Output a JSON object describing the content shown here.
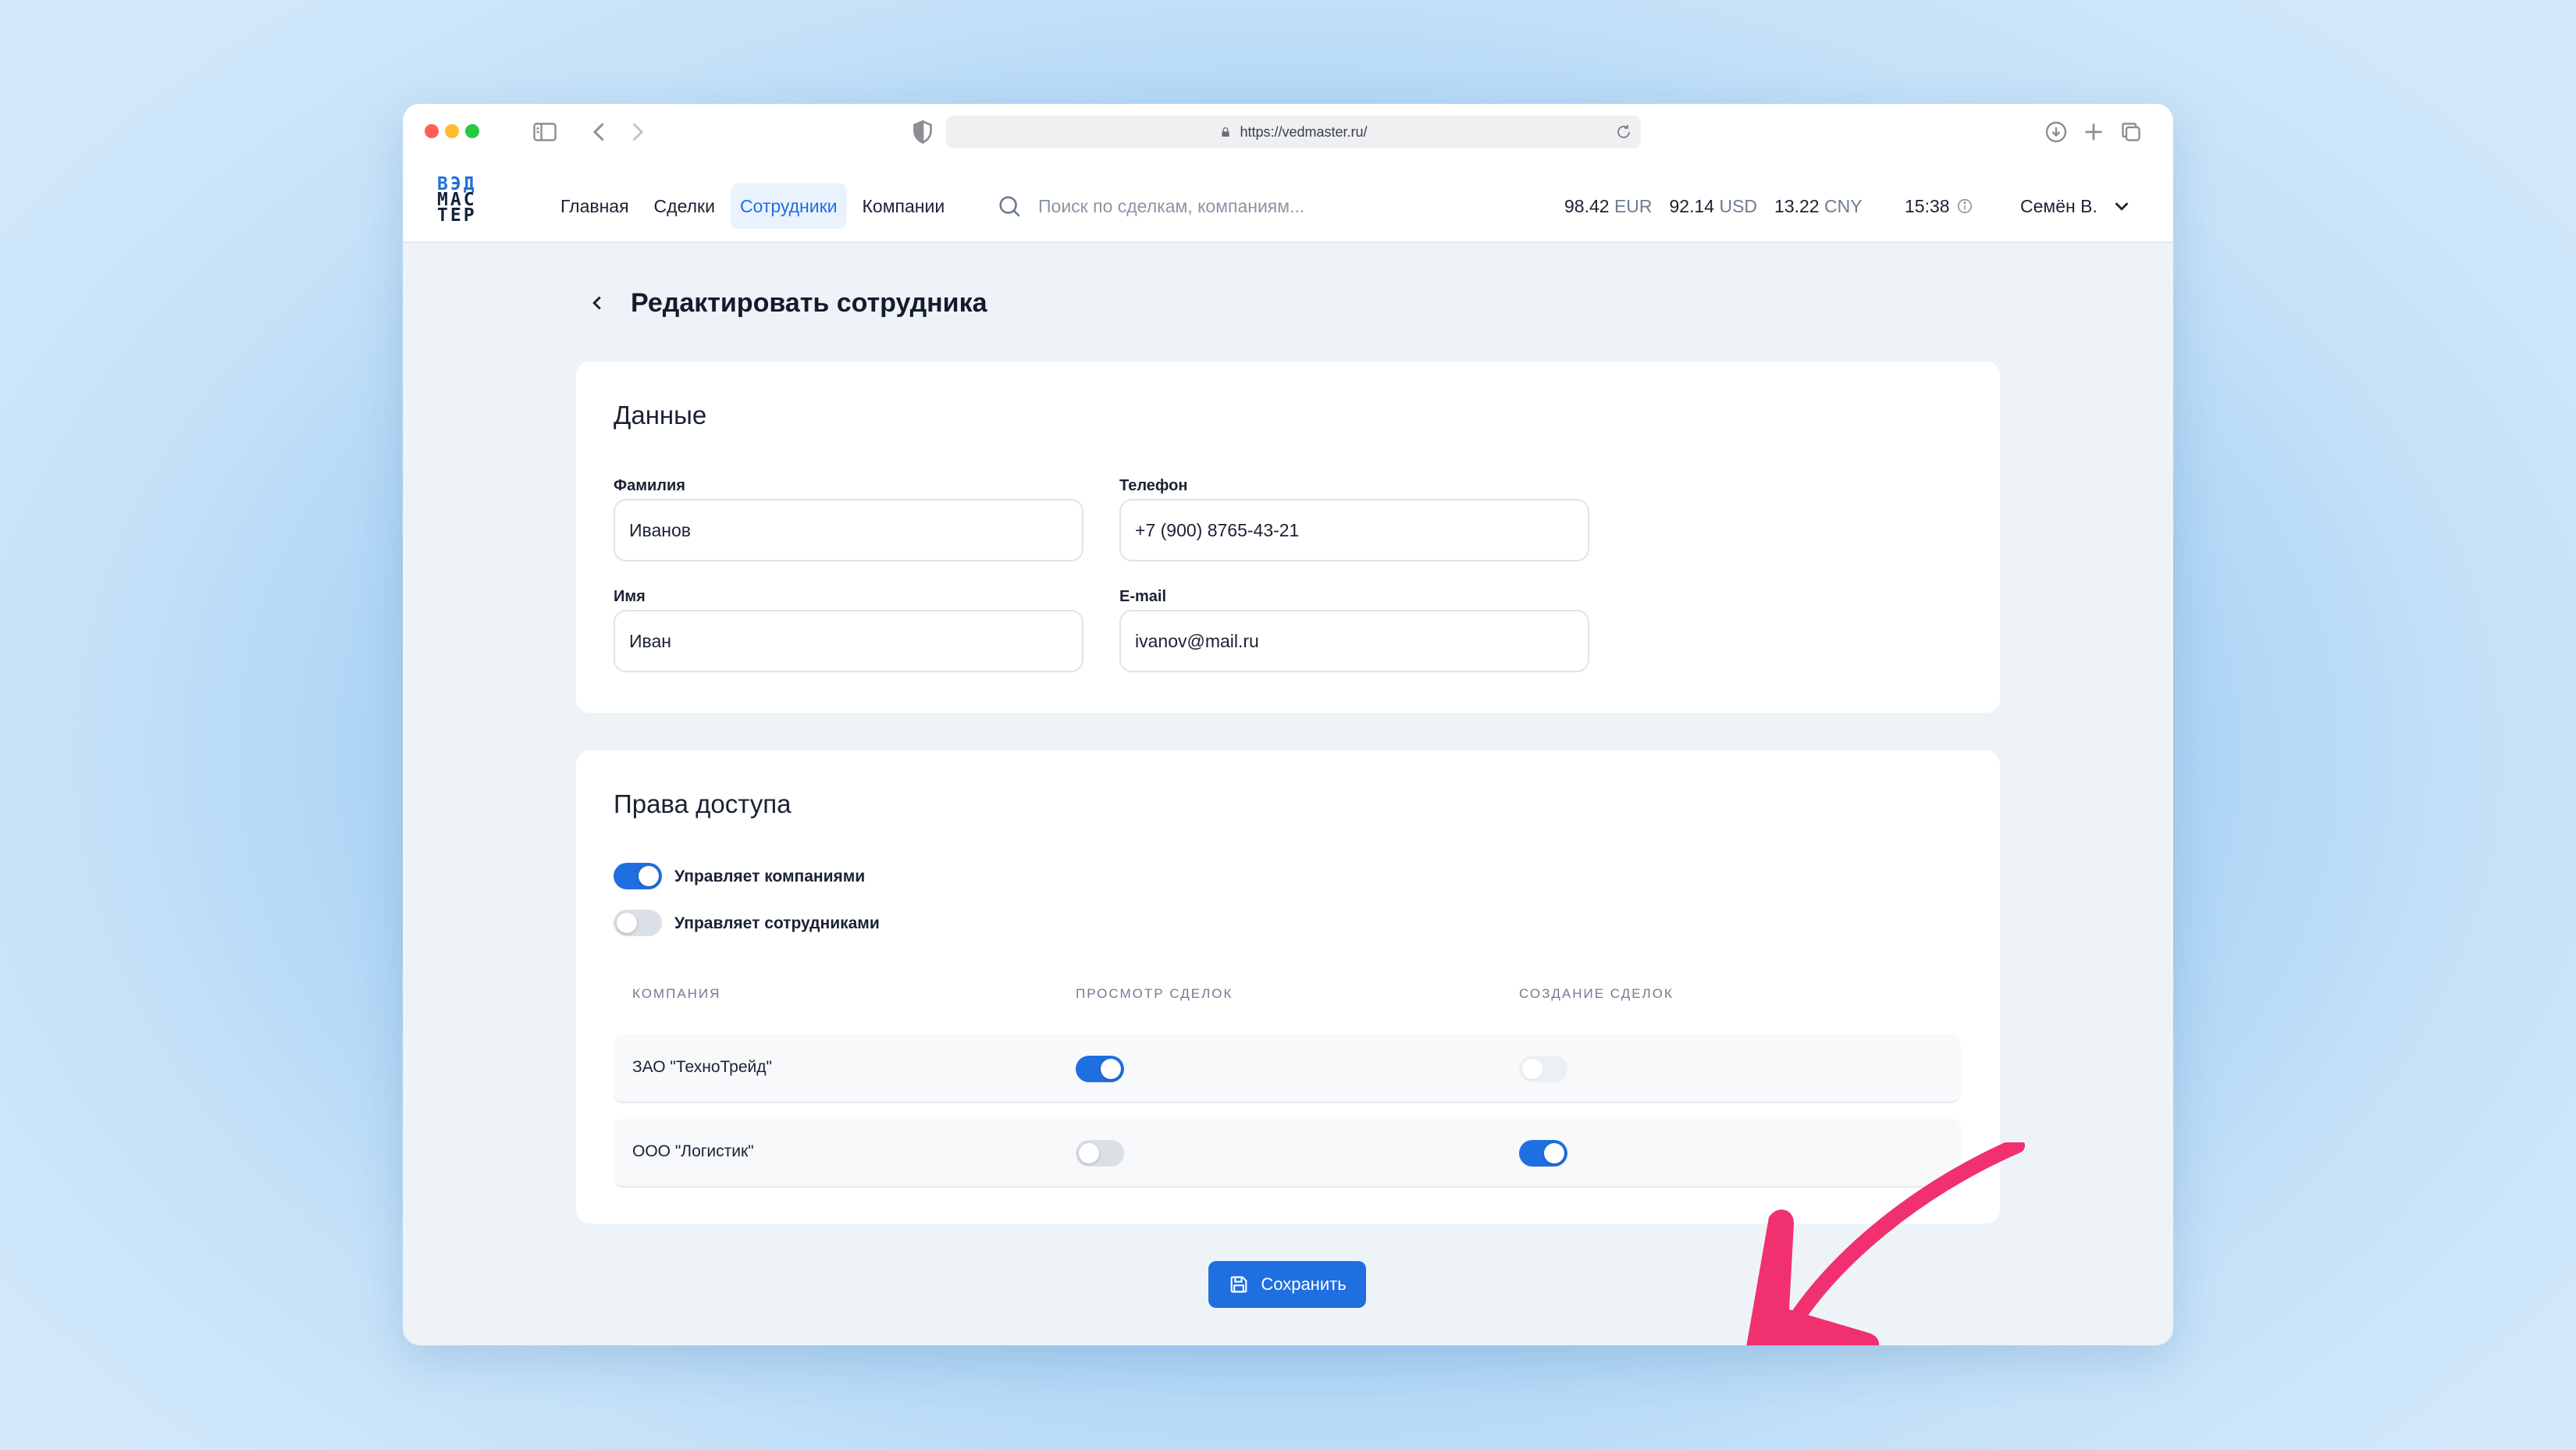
{
  "browser": {
    "url": "https://vedmaster.ru/"
  },
  "header": {
    "logo_lines": [
      "ВЭД",
      "МАС",
      "ТЕР"
    ],
    "nav": [
      {
        "label": "Главная"
      },
      {
        "label": "Сделки"
      },
      {
        "label": "Сотрудники",
        "active": true
      },
      {
        "label": "Компании"
      }
    ],
    "search_placeholder": "Поиск по сделкам, компаниям...",
    "rates": [
      {
        "value": "98.42",
        "currency": "EUR"
      },
      {
        "value": "92.14",
        "currency": "USD"
      },
      {
        "value": "13.22",
        "currency": "CNY"
      }
    ],
    "time": "15:38",
    "user": "Семён В."
  },
  "page": {
    "title": "Редактировать сотрудника"
  },
  "data_card": {
    "title": "Данные",
    "fields": {
      "last_name": {
        "label": "Фамилия",
        "value": "Иванов"
      },
      "phone": {
        "label": "Телефон",
        "value": "+7 (900) 8765-43-21"
      },
      "first_name": {
        "label": "Имя",
        "value": "Иван"
      },
      "email": {
        "label": "E-mail",
        "value": "ivanov@mail.ru"
      }
    }
  },
  "access_card": {
    "title": "Права доступа",
    "permissions": [
      {
        "label": "Управляет компаниями",
        "enabled": true
      },
      {
        "label": "Управляет сотрудниками",
        "enabled": false
      }
    ],
    "columns": [
      "Компания",
      "Просмотр сделок",
      "Создание сделок"
    ],
    "rows": [
      {
        "company": "ЗАО \"ТехноТрейд\"",
        "view": true,
        "create": false
      },
      {
        "company": "ООО \"Логистик\"",
        "view": false,
        "create": true
      }
    ]
  },
  "save_label": "Сохранить",
  "colors": {
    "accent": "#1f6fe0",
    "annotation_arrow": "#f0306f"
  }
}
